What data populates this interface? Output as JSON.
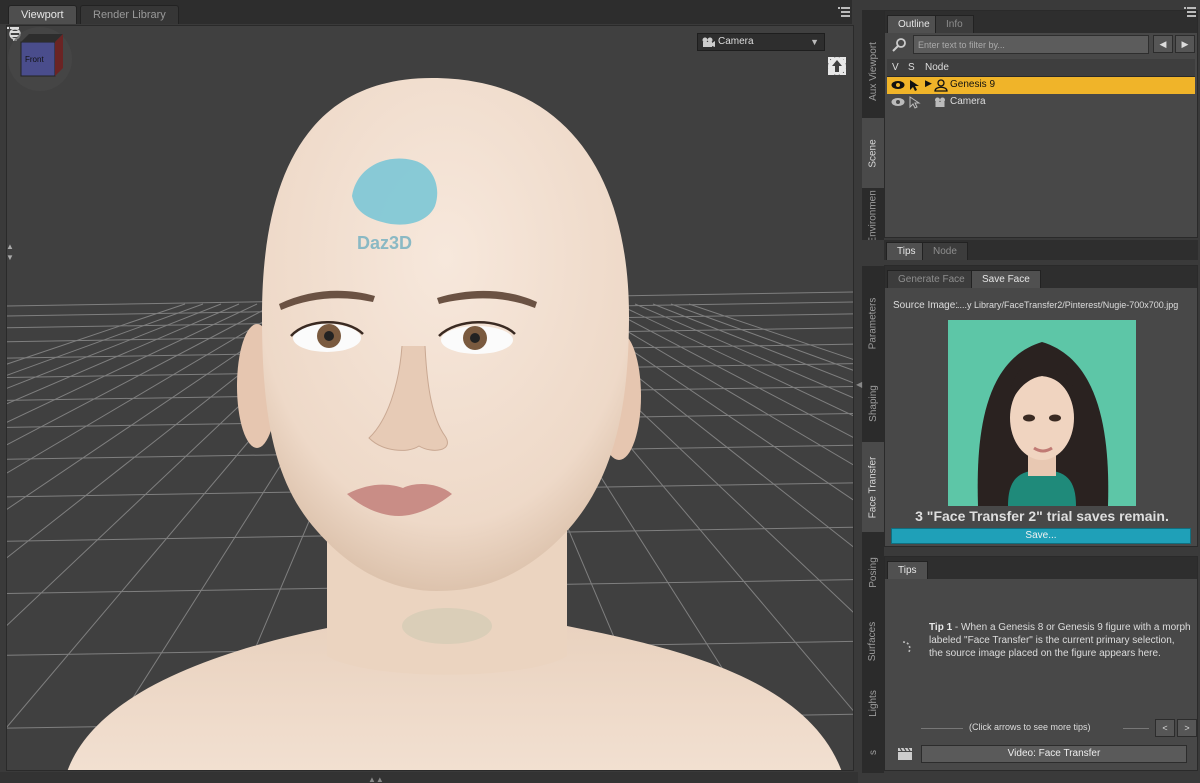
{
  "viewport_tabs": [
    {
      "label": "Viewport"
    },
    {
      "label": "Render Library"
    }
  ],
  "viewport": {
    "camera_label": "Camera",
    "dropdown_arrow": "▼",
    "nav_cube_face": "Front",
    "watermark": "Daz3D"
  },
  "scene": {
    "tabs": [
      {
        "label": "Outline"
      },
      {
        "label": "Info"
      }
    ],
    "filter_placeholder": "Enter text to filter by...",
    "nav_prev": "◀",
    "nav_next": "▶",
    "columns": {
      "v": "V",
      "s": "S",
      "node": "Node"
    },
    "rows": [
      {
        "label": "Genesis 9",
        "selected": true
      },
      {
        "label": "Camera",
        "selected": false
      }
    ]
  },
  "side_tabs_upper": [
    "Aux Viewport",
    "Scene",
    "Environment"
  ],
  "side_tabs_lower": [
    "Parameters",
    "Shaping",
    "Face Transfer",
    "Posing",
    "Surfaces",
    "Lights",
    "s"
  ],
  "tips_top_tabs": [
    {
      "label": "Tips"
    },
    {
      "label": "Node"
    }
  ],
  "face_transfer": {
    "tabs": [
      {
        "label": "Generate Face"
      },
      {
        "label": "Save Face"
      }
    ],
    "source_label": "Source Image:",
    "source_path": "....y Library/FaceTransfer2/Pinterest/Nugie-700x700.jpg",
    "trial_text": "3 \"Face Transfer 2\" trial saves remain.",
    "save_button": "Save..."
  },
  "tips": {
    "tab_label": "Tips",
    "tip_title": "Tip 1",
    "tip_body": " - When a Genesis 8 or Genesis 9 figure with a morph labeled \"Face Transfer\" is the current primary selection, the source image placed on the figure appears here.",
    "nav_text": "(Click arrows to see more tips)",
    "prev": "<",
    "next": ">",
    "video_button": "Video: Face Transfer"
  },
  "colors": {
    "selection": "#f0b429",
    "save_button": "#1fa0b8",
    "viewport_bg": "#404040",
    "skin": "#f0dccb",
    "logo": "#7cc7d6"
  }
}
